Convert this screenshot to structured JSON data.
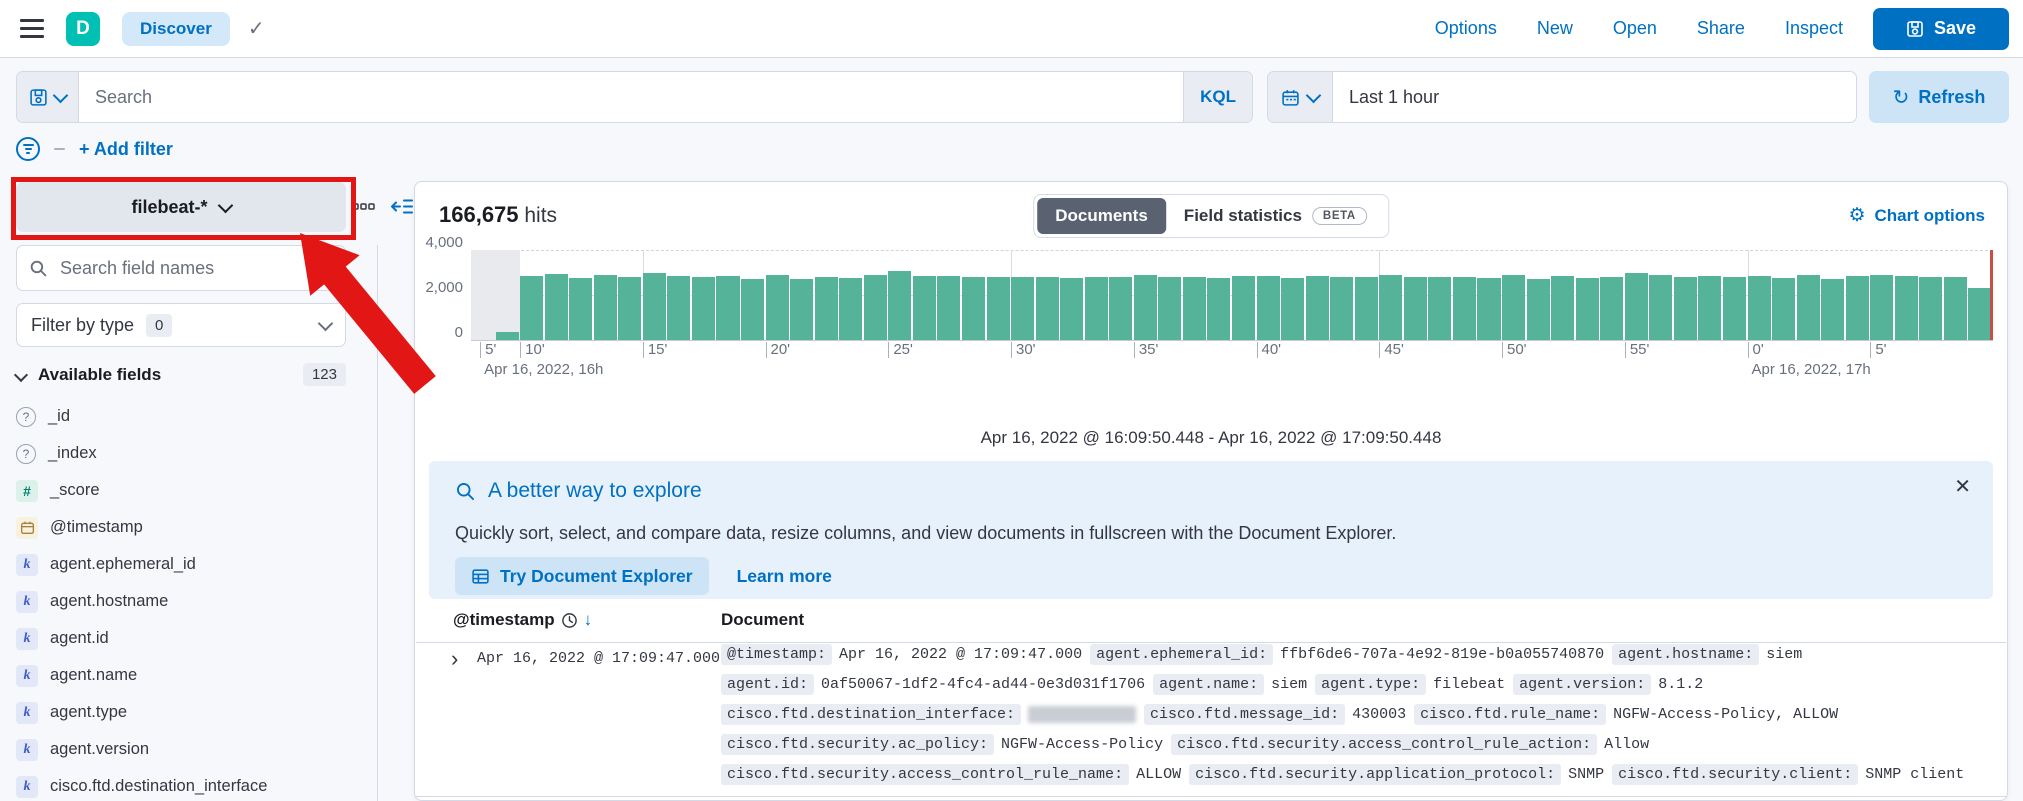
{
  "topbar": {
    "logo": "D",
    "breadcrumb": "Discover",
    "actions": [
      "Options",
      "New",
      "Open",
      "Share",
      "Inspect"
    ],
    "save_label": "Save"
  },
  "querybar": {
    "search_placeholder": "Search",
    "kql_label": "KQL",
    "time_range": "Last 1 hour",
    "refresh_label": "Refresh",
    "add_filter_label": "+ Add filter"
  },
  "sidebar": {
    "index_pattern": "filebeat-*",
    "field_search_placeholder": "Search field names",
    "filter_by_type_label": "Filter by type",
    "filter_by_type_count": "0",
    "available_fields_label": "Available fields",
    "available_fields_count": "123",
    "fields": [
      {
        "name": "_id",
        "type": "unknown"
      },
      {
        "name": "_index",
        "type": "unknown"
      },
      {
        "name": "_score",
        "type": "number"
      },
      {
        "name": "@timestamp",
        "type": "date"
      },
      {
        "name": "agent.ephemeral_id",
        "type": "keyword"
      },
      {
        "name": "agent.hostname",
        "type": "keyword"
      },
      {
        "name": "agent.id",
        "type": "keyword"
      },
      {
        "name": "agent.name",
        "type": "keyword"
      },
      {
        "name": "agent.type",
        "type": "keyword"
      },
      {
        "name": "agent.version",
        "type": "keyword"
      },
      {
        "name": "cisco.ftd.destination_interface",
        "type": "keyword"
      }
    ]
  },
  "main": {
    "hits_value": "166,675",
    "hits_label": "hits",
    "tabs": [
      {
        "label": "Documents",
        "selected": true
      },
      {
        "label": "Field statistics",
        "badge": "BETA",
        "selected": false
      }
    ],
    "chart_options_label": "Chart options",
    "time_caption": "Apr 16, 2022 @ 16:09:50.448 - Apr 16, 2022 @ 17:09:50.448"
  },
  "chart_data": {
    "type": "bar",
    "interval": "1 minute",
    "y_max": 4000,
    "y_ticks": [
      "4,000",
      "2,000",
      "0"
    ],
    "bar_color": "#54b399",
    "partial_band_pct": 3.23,
    "values": [
      350,
      2850,
      2950,
      2760,
      2890,
      2800,
      2960,
      2830,
      2800,
      2840,
      2690,
      2910,
      2730,
      2820,
      2750,
      2890,
      3060,
      2830,
      2850,
      2790,
      2790,
      2790,
      2790,
      2770,
      2780,
      2790,
      2910,
      2810,
      2790,
      2760,
      2830,
      2830,
      2770,
      2850,
      2790,
      2790,
      2870,
      2790,
      2810,
      2810,
      2770,
      2890,
      2690,
      2830,
      2770,
      2790,
      2990,
      2890,
      2810,
      2850,
      2790,
      2850,
      2770,
      2910,
      2690,
      2830,
      2910,
      2830,
      2790,
      2810,
      2300
    ],
    "x_ticks": [
      {
        "label": "5'",
        "pct": 0.6,
        "sub": "Apr 16, 2022, 16h"
      },
      {
        "label": "10'",
        "pct": 3.23
      },
      {
        "label": "15'",
        "pct": 11.29
      },
      {
        "label": "20'",
        "pct": 19.35
      },
      {
        "label": "25'",
        "pct": 27.42
      },
      {
        "label": "30'",
        "pct": 35.48
      },
      {
        "label": "35'",
        "pct": 43.55
      },
      {
        "label": "40'",
        "pct": 51.61
      },
      {
        "label": "45'",
        "pct": 59.68
      },
      {
        "label": "50'",
        "pct": 67.74
      },
      {
        "label": "55'",
        "pct": 75.81
      },
      {
        "label": "0'",
        "pct": 83.87,
        "sub": "Apr 16, 2022, 17h"
      },
      {
        "label": "5'",
        "pct": 91.94
      }
    ],
    "gridlines_pct": [
      11.29,
      35.48,
      59.68,
      83.87
    ]
  },
  "callout": {
    "title": "A better way to explore",
    "body": "Quickly sort, select, and compare data, resize columns, and view documents in fullscreen with the Document Explorer.",
    "primary_button": "Try Document Explorer",
    "link": "Learn more",
    "close": "✕"
  },
  "doc_table": {
    "col_timestamp": "@timestamp",
    "col_document": "Document",
    "rows": [
      {
        "timestamp": "Apr 16, 2022 @ 17:09:47.000",
        "fields": [
          {
            "f": "@timestamp",
            "v": "Apr 16, 2022 @ 17:09:47.000"
          },
          {
            "f": "agent.ephemeral_id",
            "v": "ffbf6de6-707a-4e92-819e-b0a055740870"
          },
          {
            "f": "agent.hostname",
            "v": "siem"
          },
          {
            "f": "agent.id",
            "v": "0af50067-1df2-4fc4-ad44-0e3d031f1706"
          },
          {
            "f": "agent.name",
            "v": "siem"
          },
          {
            "f": "agent.type",
            "v": "filebeat"
          },
          {
            "f": "agent.version",
            "v": "8.1.2"
          },
          {
            "f": "cisco.ftd.destination_interface",
            "v": "",
            "redacted": true
          },
          {
            "f": "cisco.ftd.message_id",
            "v": "430003"
          },
          {
            "f": "cisco.ftd.rule_name",
            "v": "NGFW-Access-Policy, ALLOW"
          },
          {
            "f": "cisco.ftd.security.ac_policy",
            "v": "NGFW-Access-Policy"
          },
          {
            "f": "cisco.ftd.security.access_control_rule_action",
            "v": "Allow"
          },
          {
            "f": "cisco.ftd.security.access_control_rule_name",
            "v": "ALLOW"
          },
          {
            "f": "cisco.ftd.security.application_protocol",
            "v": "SNMP"
          },
          {
            "f": "cisco.ftd.security.client",
            "v": "SNMP client"
          }
        ]
      }
    ]
  },
  "annotation": {
    "highlight_color": "#e31616",
    "target": "index-pattern-selector"
  }
}
